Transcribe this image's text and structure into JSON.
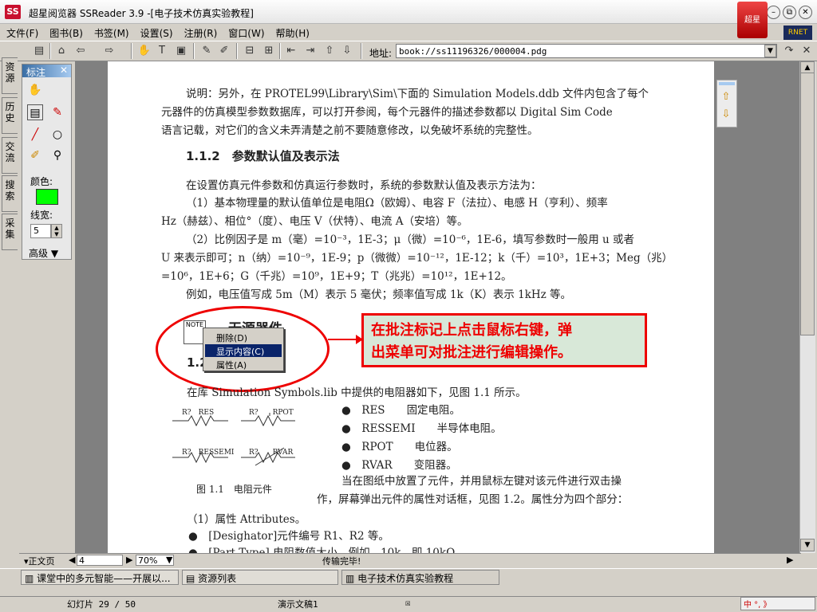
{
  "window": {
    "title": "超星阅览器 SSReader 3.9 -[电子技术仿真实验教程]",
    "logo": "SS",
    "brand": "超星",
    "globe": "RNET"
  },
  "menu": [
    "文件(F)",
    "图书(B)",
    "书签(M)",
    "设置(S)",
    "注册(R)",
    "窗口(W)",
    "帮助(H)"
  ],
  "address": {
    "label": "地址:",
    "value": "book://ss11196326/000004.pdg"
  },
  "side_tabs": [
    "资源",
    "历史",
    "交流",
    "搜索",
    "采集"
  ],
  "palette": {
    "title": "标注",
    "color_label": "颜色:",
    "color": "#00ff00",
    "width_label": "线宽:",
    "width_value": "5",
    "advanced": "高级 ▼"
  },
  "doc": {
    "p1": [
      "说明：另外，在 PROTEL99\\Library\\Sim\\下面的 Simulation Models.ddb 文件内包含了每个",
      "元器件的仿真模型参数数据库，可以打开参阅，每个元器件的描述参数都以 Digital Sim Code",
      "语言记载，对它们的含义未弄清楚之前不要随意修改，以免破坏系统的完整性。"
    ],
    "h112": "1.1.2　参数默认值及表示法",
    "p2": [
      "在设置仿真元件参数和仿真运行参数时，系统的参数默认值及表示方法为：",
      "（1）基本物理量的默认值单位是电阻Ω（欧姆）、电容 F（法拉）、电感 H（亨利）、频率",
      "Hz（赫兹）、相位°（度）、电压 V（伏特）、电流 A（安培）等。",
      "（2）比例因子是 m（毫）=10⁻³，1E-3；μ（微）=10⁻⁶，1E-6，填写参数时一般用 u 或者",
      "U 来表示即可；n（纳）=10⁻⁹，1E-9；p（微微）=10⁻¹²，1E-12；k（千）=10³，1E+3；Meg（兆）",
      "=10⁶，1E+6；G（千兆）=10⁹，1E+9；T（兆兆）=10¹²，1E+12。",
      "例如，电压值写成 5m（M）表示 5 毫伏；频率值写成 1k（K）表示 1kHz 等。"
    ],
    "h13": "无源器件",
    "h13num": "1.2",
    "note_label": "NOTE",
    "menu_items": [
      "删除(D)",
      "显示内容(C)",
      "属性(A)"
    ],
    "callout": [
      "在批注标记上点击鼠标右键，弹",
      "出菜单可对批注进行编辑操作。"
    ],
    "p3": "在库 Simulation Symbols.lib 中提供的电阻器如下，见图 1.1 所示。",
    "res_labels": [
      "R?　RES",
      "R?　　RPOT",
      "R?　RESSEMI",
      "R?　　RVAR"
    ],
    "fig": "图 1.1　电阻元件",
    "bullets": [
      [
        "RES",
        "固定电阻。"
      ],
      [
        "RESSEMI",
        "半导体电阻。"
      ],
      [
        "RPOT",
        "电位器。"
      ],
      [
        "RVAR",
        "变阻器。"
      ]
    ],
    "p4": [
      "当在图纸中放置了元件，并用鼠标左键对该元件进行双击操",
      "作，屏幕弹出元件的属性对话框，见图 1.2。属性分为四个部分："
    ],
    "p5": "（1）属性 Attributes。",
    "b2": [
      "[Desighator]元件编号 R1、R2 等。",
      "[Part Type] 电阻数值大小，例如，10k，即 10kΩ。"
    ]
  },
  "bottom": {
    "page_type": "▾正文页",
    "page_no": "4",
    "zoom": "70%",
    "status": "传输完毕!"
  },
  "tasks": [
    "课堂中的多元智能——开展以...",
    "资源列表",
    "电子技术仿真实验教程"
  ],
  "statusbar": {
    "slide": "幻灯片 29 / 50",
    "doc": "演示文稿1",
    "lang": "中 °, 》"
  }
}
